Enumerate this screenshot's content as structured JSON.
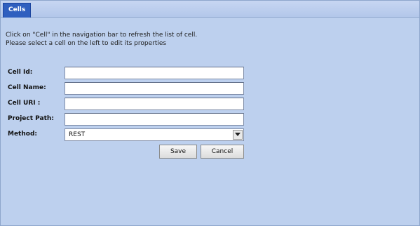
{
  "tab": {
    "label": "Cells"
  },
  "instructions": {
    "line1": "Click on \"Cell\" in the navigation bar to refresh the list of cell.",
    "line2": "Please select a cell on the left to edit its properties"
  },
  "form": {
    "cell_id_label": "Cell Id:",
    "cell_id_value": "",
    "cell_name_label": "Cell Name:",
    "cell_name_value": "",
    "cell_url_label": "Cell URI :",
    "cell_url_value": "",
    "project_path_label": "Project Path:",
    "project_path_value": "",
    "method_label": "Method:",
    "method_value": "REST",
    "save_label": "Save",
    "cancel_label": "Cancel"
  },
  "colors": {
    "panel_background": "#bdd0ee",
    "tab_background": "#2f5fbf"
  },
  "icons": {
    "dropdown": "chevron-down-icon"
  }
}
